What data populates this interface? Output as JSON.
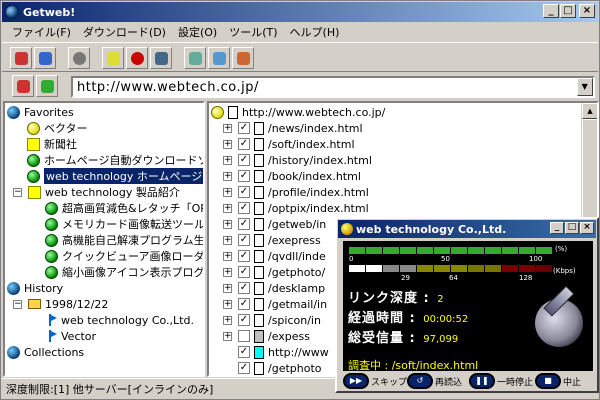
{
  "window": {
    "title": "Getweb!",
    "min_btn": "_",
    "max_btn": "□",
    "close_btn": "×"
  },
  "menu": [
    "ファイル(F)",
    "ダウンロード(D)",
    "設定(O)",
    "ツール(T)",
    "ヘルプ(H)"
  ],
  "address": {
    "url": "http://www.webtech.co.jp/",
    "dropdown": "▼"
  },
  "tree": {
    "favorites": "Favorites",
    "fav_items": [
      "ベクター",
      "新聞社",
      "ホームページ自動ダウンロードソフ",
      "web technology ホームページ"
    ],
    "product_folder": "web technology 製品紹介",
    "products": [
      "超高画質減色&レタッチ「OPT",
      "メモリカード画像転送ツール「C",
      "高機能自己解凍プログラム生",
      "クイックビューア画像ローダー",
      "縮小画像アイコン表示プログラ"
    ],
    "history": "History",
    "history_date": "1998/12/22",
    "history_items": [
      "web technology Co.,Ltd.",
      "Vector"
    ],
    "collections": "Collections"
  },
  "files": {
    "root": "http://www.webtech.co.jp/",
    "items": [
      "/news/index.html",
      "/soft/index.html",
      "/history/index.html",
      "/book/index.html",
      "/profile/index.html",
      "/optpix/index.html",
      "/getweb/in",
      "/exepress",
      "/qvdll/inde",
      "/getphoto/",
      "/desklamp",
      "/getmail/in",
      "/spicon/in",
      "/expess",
      "http://www",
      "/getphoto"
    ]
  },
  "status": "深度制限:[1]  他サーバー[インラインのみ]",
  "popup": {
    "title": "web technology Co.,Ltd.",
    "scale_top": [
      "0",
      "50",
      "100"
    ],
    "unit_top": "(%)",
    "scale_bottom": [
      "29",
      "64",
      "128"
    ],
    "unit_bottom": "(Kbps)",
    "depth_label": "リンク深度",
    "depth_value": "2",
    "time_label": "経過時間",
    "time_value": "00:00:52",
    "size_label": "総受信量",
    "size_value": "97,099",
    "survey": "調査中 : /soft/index.html",
    "btn_skip": "スキップ",
    "btn_reload": "再読込",
    "btn_pause": "一時停止",
    "btn_stop": "中止"
  }
}
